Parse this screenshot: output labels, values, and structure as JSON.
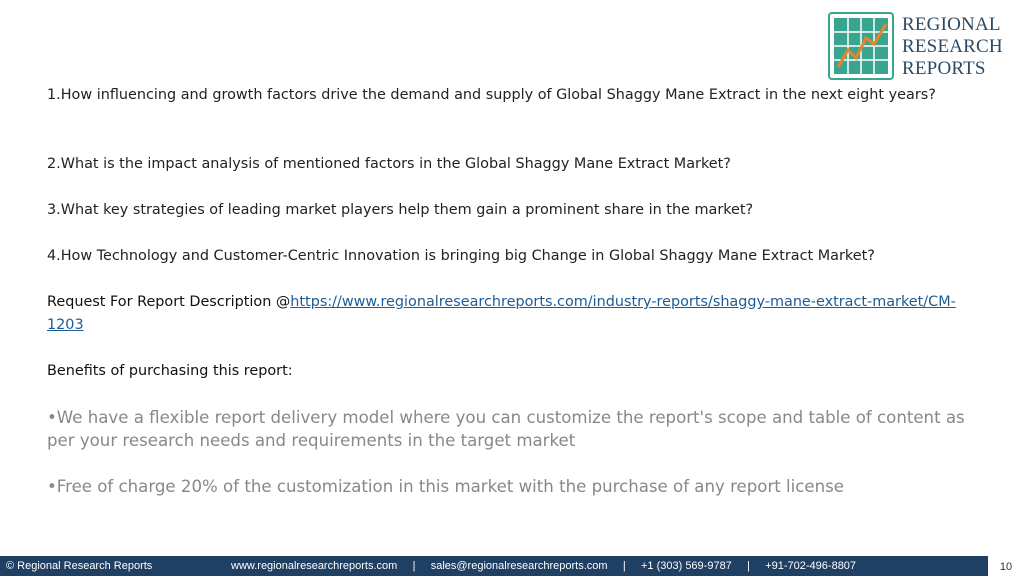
{
  "logo": {
    "line1": "REGIONAL",
    "line2": "RESEARCH",
    "line3": "REPORTS"
  },
  "questions": {
    "q1": "1.How influencing and growth factors drive the demand and supply of Global Shaggy Mane Extract in the next eight years?",
    "q2": "2.What is the impact analysis of mentioned factors in the Global Shaggy Mane Extract Market?",
    "q3": "3.What key strategies of leading market players help them gain a prominent share in the market?",
    "q4": "4.How Technology and Customer-Centric Innovation is bringing big Change in Global Shaggy Mane Extract Market?"
  },
  "request": {
    "label": "Request For Report Description @",
    "link": "https://www.regionalresearchreports.com/industry-reports/shaggy-mane-extract-market/CM-1203"
  },
  "benefits_heading": "Benefits of purchasing this report:",
  "bullets": {
    "b1": "•We have a flexible report delivery model where you can customize the report's scope and table of content as per your research needs and requirements in the target market",
    "b2": "•Free of charge 20% of the customization in this market with the purchase of any report license"
  },
  "footer": {
    "copyright": "© Regional Research Reports",
    "contacts": "www.regionalresearchreports.com     |     sales@regionalresearchreports.com     |     +1 (303) 569-9787     |     +91-702-496-8807",
    "page_number": "10"
  },
  "colors": {
    "footer_bg": "#1f3f63",
    "logo_teal": "#3aa58f",
    "link": "#1d5c96"
  }
}
